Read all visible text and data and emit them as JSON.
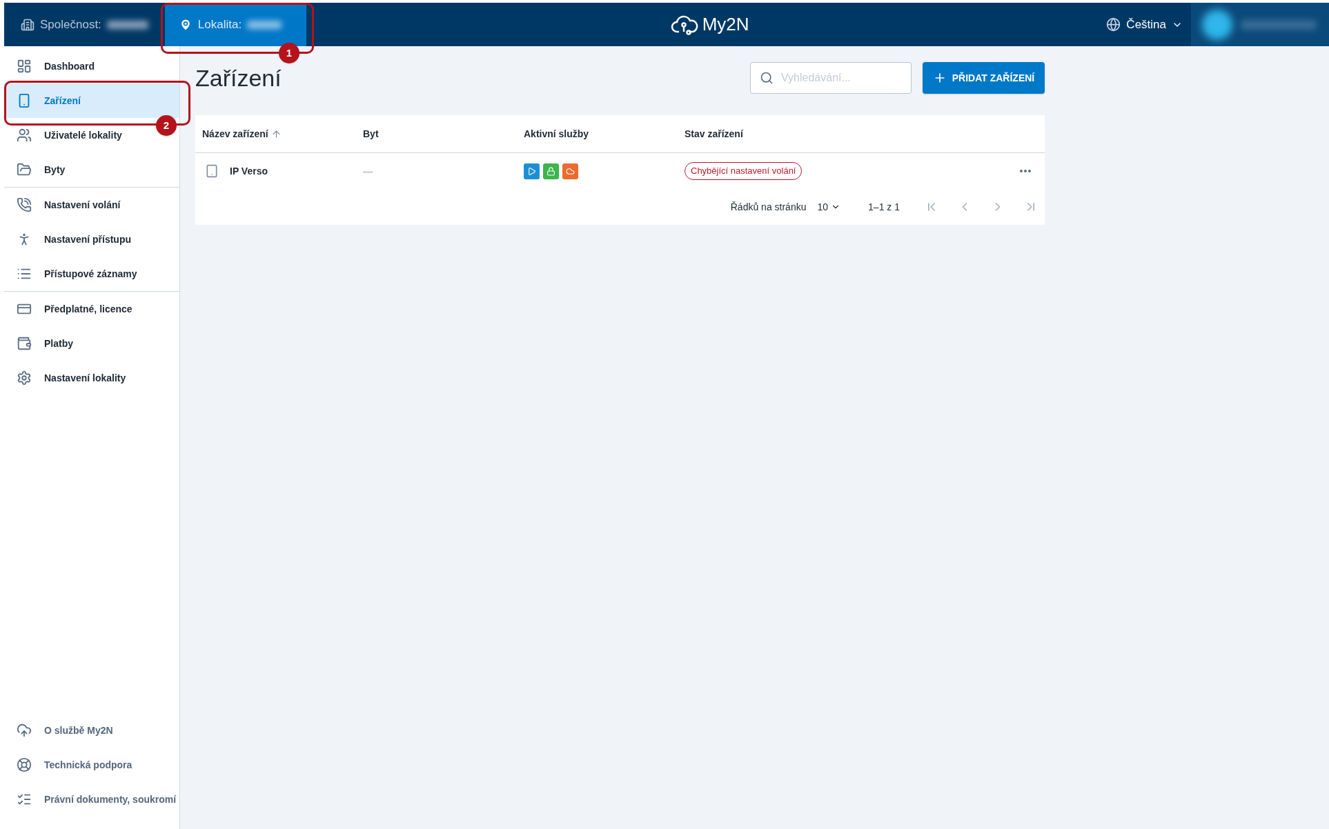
{
  "top_bar": {
    "company": {
      "label": "Společnost:",
      "selected": false
    },
    "location": {
      "label": "Lokalita:",
      "selected": true
    },
    "logo": "My2N",
    "language": "Čeština"
  },
  "sidebar": {
    "groups": [
      [
        {
          "label": "Dashboard",
          "selected": false
        },
        {
          "label": "Zařízení",
          "selected": true
        },
        {
          "label": "Uživatelé lokality",
          "selected": false
        },
        {
          "label": "Byty",
          "selected": false
        }
      ],
      [
        {
          "label": "Nastavení volání",
          "selected": false
        },
        {
          "label": "Nastavení přístupu",
          "selected": false
        },
        {
          "label": "Přístupové záznamy",
          "selected": false
        }
      ],
      [
        {
          "label": "Předplatné, licence",
          "selected": false
        },
        {
          "label": "Platby",
          "selected": false
        },
        {
          "label": "Nastavení lokality",
          "selected": false
        }
      ]
    ],
    "footer": [
      {
        "label": "O službě My2N"
      },
      {
        "label": "Technická podpora"
      },
      {
        "label": "Právní dokumenty, soukromí"
      }
    ]
  },
  "page": {
    "title": "Zařízení",
    "search": {
      "placeholder": "Vyhledávání..."
    },
    "add_button": "PŘIDAT ZAŘÍZENÍ"
  },
  "table": {
    "columns": [
      {
        "label": "Název zařízení",
        "sorted": true
      },
      {
        "label": "Byt",
        "sorted": false
      },
      {
        "label": "Aktivní služby",
        "sorted": false
      },
      {
        "label": "Stav zařízení",
        "sorted": false
      }
    ],
    "rows": [
      {
        "name": "IP Verso",
        "apartment": "—",
        "services": [
          {
            "color": "#1e8fd6"
          },
          {
            "color": "#3cb54a"
          },
          {
            "color": "#ef6a2e"
          }
        ],
        "status": "Chybějící nastavení volání"
      }
    ],
    "pagination": {
      "rows_label": "Řádků na stránku",
      "rows_value": "10",
      "range": "1–1 z 1"
    }
  },
  "annotations": [
    {
      "label": "1"
    },
    {
      "label": "2"
    }
  ]
}
